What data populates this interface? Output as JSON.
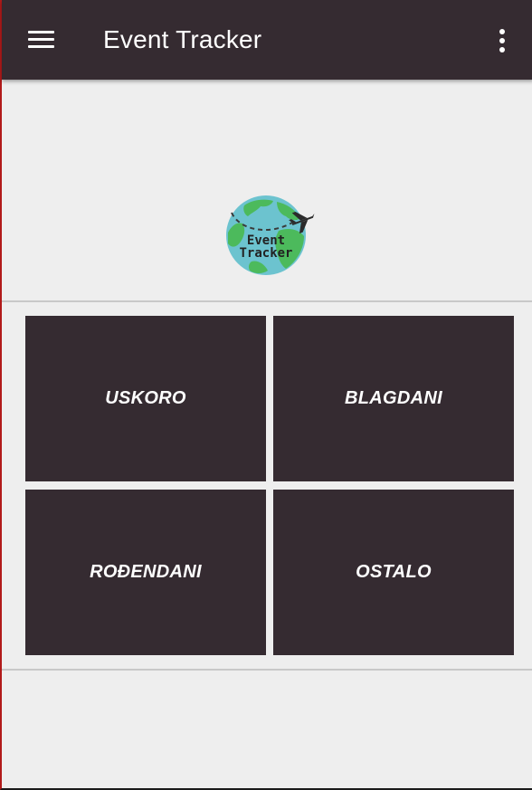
{
  "app_bar": {
    "title": "Event Tracker",
    "menu_icon": "hamburger-menu-icon",
    "overflow_icon": "more-vert-icon",
    "background": "#352b31"
  },
  "logo": {
    "line1": "Event",
    "line2": "Tracker",
    "icon": "globe-with-airplane",
    "colors": {
      "ocean": "#6cc3cf",
      "land": "#4cba5c",
      "plane": "#2b2b2b"
    }
  },
  "categories": [
    {
      "label": "USKORO"
    },
    {
      "label": "BLAGDANI"
    },
    {
      "label": "ROĐENDANI"
    },
    {
      "label": "OSTALO"
    }
  ],
  "colors": {
    "tile_background": "#352b31",
    "page_background": "#eeeeee",
    "divider": "#c8c8c8"
  }
}
